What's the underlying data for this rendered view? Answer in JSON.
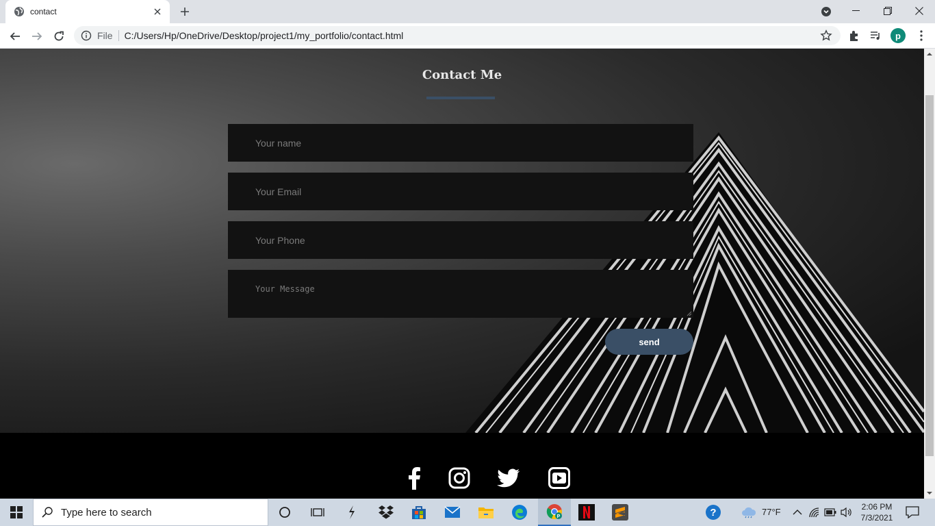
{
  "browser": {
    "tab_title": "contact",
    "omnibox": {
      "scheme_label": "File",
      "url": "C:/Users/Hp/OneDrive/Desktop/project1/my_portfolio/contact.html"
    },
    "profile_initial": "p",
    "profile_color": "#0f8a78"
  },
  "page": {
    "heading": "Contact Me",
    "accent_color": "#3a4f66",
    "form": {
      "name_placeholder": "Your name",
      "email_placeholder": "Your Email",
      "phone_placeholder": "Your Phone",
      "message_placeholder": "Your Message",
      "send_label": "send"
    },
    "footer": {
      "social_icons": [
        "facebook-icon",
        "instagram-icon",
        "twitter-icon",
        "youtube-icon"
      ]
    }
  },
  "taskbar": {
    "search_placeholder": "Type here to search",
    "weather": "77°F",
    "time": "2:06 PM",
    "date": "7/3/2021"
  }
}
